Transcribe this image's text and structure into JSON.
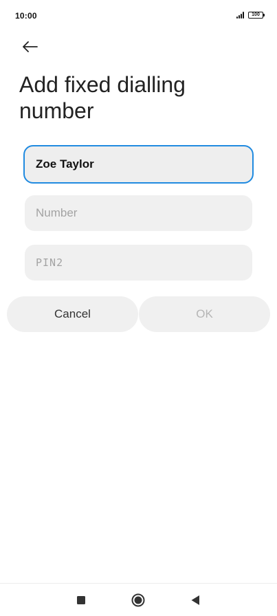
{
  "status_bar": {
    "time": "10:00",
    "battery": "100"
  },
  "header": {
    "title": "Add fixed dialling number"
  },
  "form": {
    "name": {
      "value": "Zoe Taylor",
      "placeholder": ""
    },
    "number": {
      "value": "",
      "placeholder": "Number"
    },
    "pin2": {
      "value": "",
      "placeholder": "PIN2"
    }
  },
  "actions": {
    "cancel_label": "Cancel",
    "ok_label": "OK"
  },
  "colors": {
    "accent": "#1f8ae0",
    "field_bg": "#f0f0f0",
    "disabled_text": "#b5b5b5"
  },
  "icons": {
    "back": "arrow-left-icon",
    "recent": "square-icon",
    "home": "circle-icon",
    "nav_back": "triangle-left-icon"
  }
}
